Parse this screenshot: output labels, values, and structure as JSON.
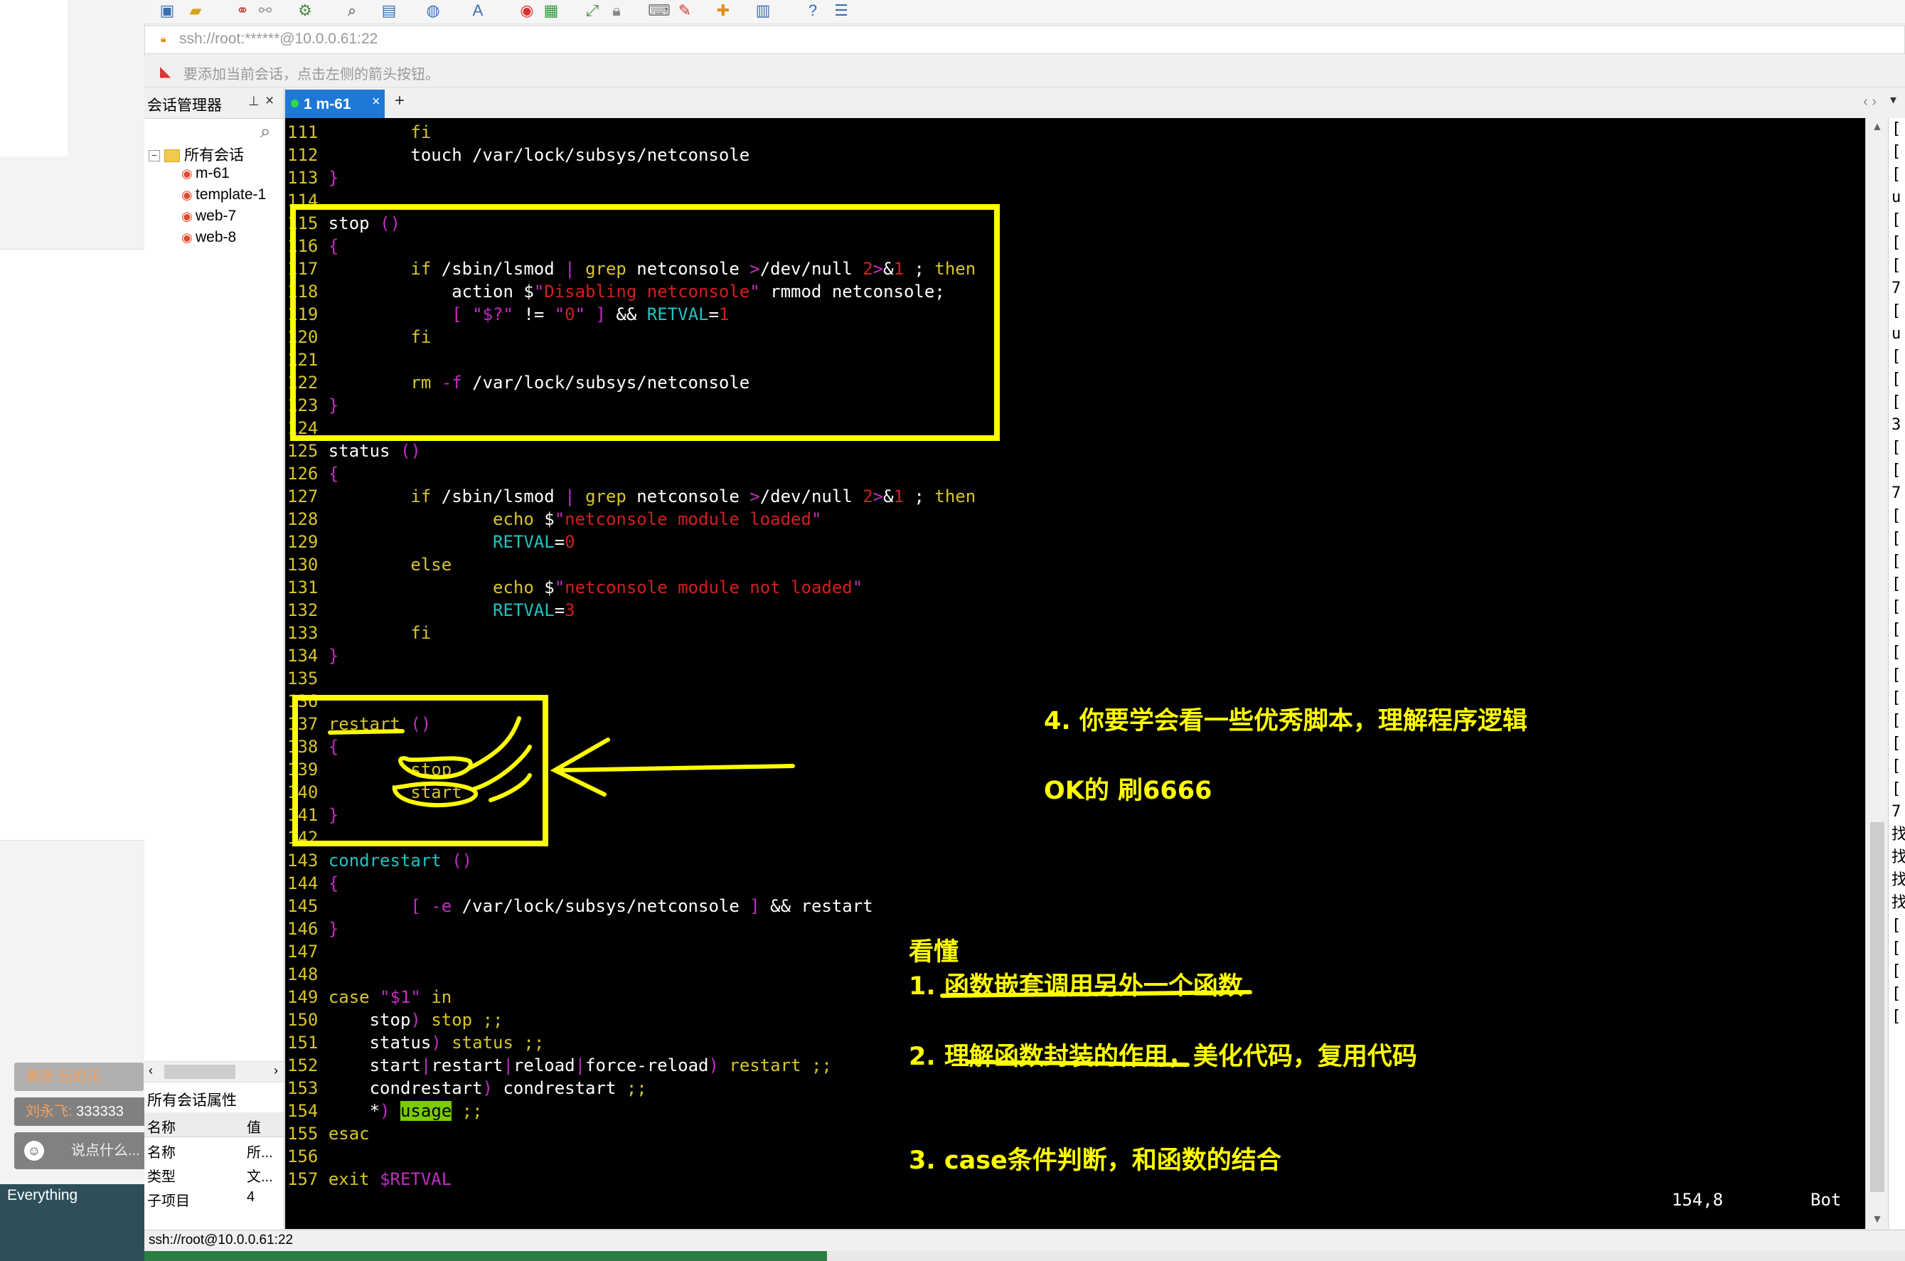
{
  "left_panel": {
    "chat_messages": [
      {
        "name": "黄彦:",
        "text": "玩的花"
      },
      {
        "name": "刘永飞:",
        "text": "333333"
      }
    ],
    "chat_placeholder": "说点什么...",
    "everything_label": "Everything"
  },
  "address_bar": {
    "url": "ssh://root:******@10.0.0.61:22"
  },
  "hint_bar": {
    "text": "要添加当前会话，点击左侧的箭头按钮。"
  },
  "session_manager": {
    "title": "会话管理器",
    "root": "所有会话",
    "sessions": [
      "m-61",
      "template-1",
      "web-7",
      "web-8"
    ],
    "props_title": "所有会话属性",
    "props_header": {
      "key": "名称",
      "value": "值"
    },
    "props": [
      {
        "key": "名称",
        "value": "所..."
      },
      {
        "key": "类型",
        "value": "文..."
      },
      {
        "key": "子项目",
        "value": "4"
      }
    ]
  },
  "tabs": [
    {
      "label": "1 m-61",
      "active": true
    }
  ],
  "terminal": {
    "cursor_position": "154,8",
    "scroll_state": "Bot",
    "highlight_color": "#7acb00"
  },
  "status_bar": {
    "text": "ssh://root@10.0.0.61:22"
  },
  "annotations": {
    "note4": "4. 你要学会看一些优秀脚本，理解程序逻辑",
    "note_ok": "OK的  刷6666",
    "note_understand": "看懂",
    "note1": "1. 函数嵌套调用另外一个函数",
    "note2": "2.  理解函数封装的作用，美化代码，复用代码",
    "note3": "3. case条件判断，和函数的结合",
    "color": "#ffff00"
  },
  "right_strip_chars": "[\n[\n[\nu\n[\n[\n[\n7\n[\nu\n[\n[\n[\n3\n[\n[\n7\n[\n[\n[\n[\n[\n[\n[\n[\n[\n[\n[\n[\n[\n7\n找\n找\n找\n找\n[\n[\n[\n[\n["
}
